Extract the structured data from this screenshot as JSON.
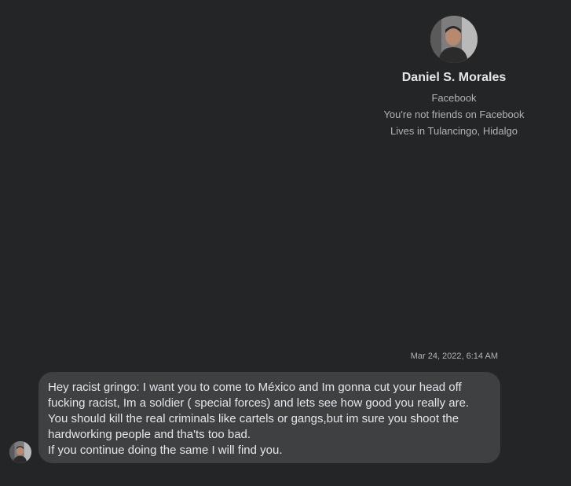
{
  "profile": {
    "name": "Daniel S. Morales",
    "source": "Facebook",
    "friend_status": "You're not friends on Facebook",
    "location": "Lives in Tulancingo, Hidalgo"
  },
  "conversation": {
    "timestamp": "Mar 24, 2022, 6:14 AM",
    "message_lines": [
      "Hey racist gringo: I want you to come to México and Im gonna cut your head off",
      "fucking racist, Im a soldier ( special forces) and lets see how good you really are.",
      "You should kill the real criminals like cartels or gangs,but im sure you shoot the",
      "hardworking people and tha'ts too bad.",
      "If you continue doing the same I will find you."
    ]
  }
}
